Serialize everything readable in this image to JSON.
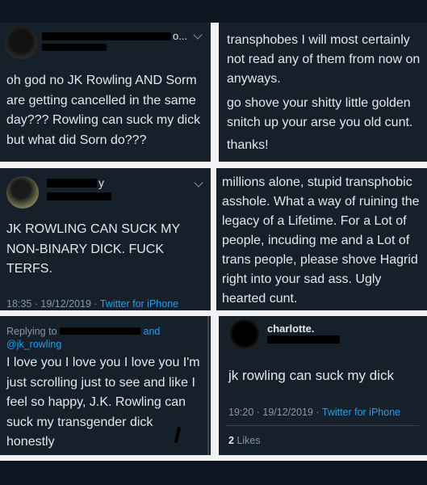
{
  "panel1": {
    "text": "oh god no JK Rowling AND Sorm are getting cancelled in the same day??? Rowling can suck my dick but what did Sorn do???",
    "handle_suffix": "o..."
  },
  "panel2": {
    "text_lines": [
      "transphobes I will most certainly",
      "not read any of them from now on",
      "anyways.",
      "go shove your shitty little golden",
      "snitch up your arse you old cunt.",
      "thanks!"
    ]
  },
  "panel3": {
    "name_fragment": "y",
    "text": "JK ROWLING CAN SUCK MY NON-BINARY DICK. FUCK TERFS.",
    "timestamp": "18:35 · 19/12/2019 ·",
    "source": "Twitter for iPhone"
  },
  "panel4": {
    "text_lines": [
      "millions alone, stupid transphobic",
      "asshole. What a way of ruining the",
      "legacy of a Lifetime. For a Lot of",
      "people, incuding me and a Lot of",
      "trans people, please shove Hagrid",
      "right into your sad ass. Ugly",
      "hearted cunt."
    ]
  },
  "panel5": {
    "replying_prefix": "Replying to",
    "replying_and": "and",
    "replying_handle": "@jk_rowling",
    "text": "I love you I love you I love you I'm just scrolling just to see and like I feel so happy, J.K. Rowling can suck my transgender dick honestly"
  },
  "panel6": {
    "name": "charlotte.",
    "text": "jk rowling can suck my dick",
    "timestamp": "19:20 · 19/12/2019 ·",
    "source": "Twitter for iPhone",
    "likes_count": "2",
    "likes_label": "Likes"
  },
  "colors": {
    "background": "#15202b",
    "text": "#e1e8ed",
    "muted": "#8899a6",
    "link": "#1da1f2"
  }
}
